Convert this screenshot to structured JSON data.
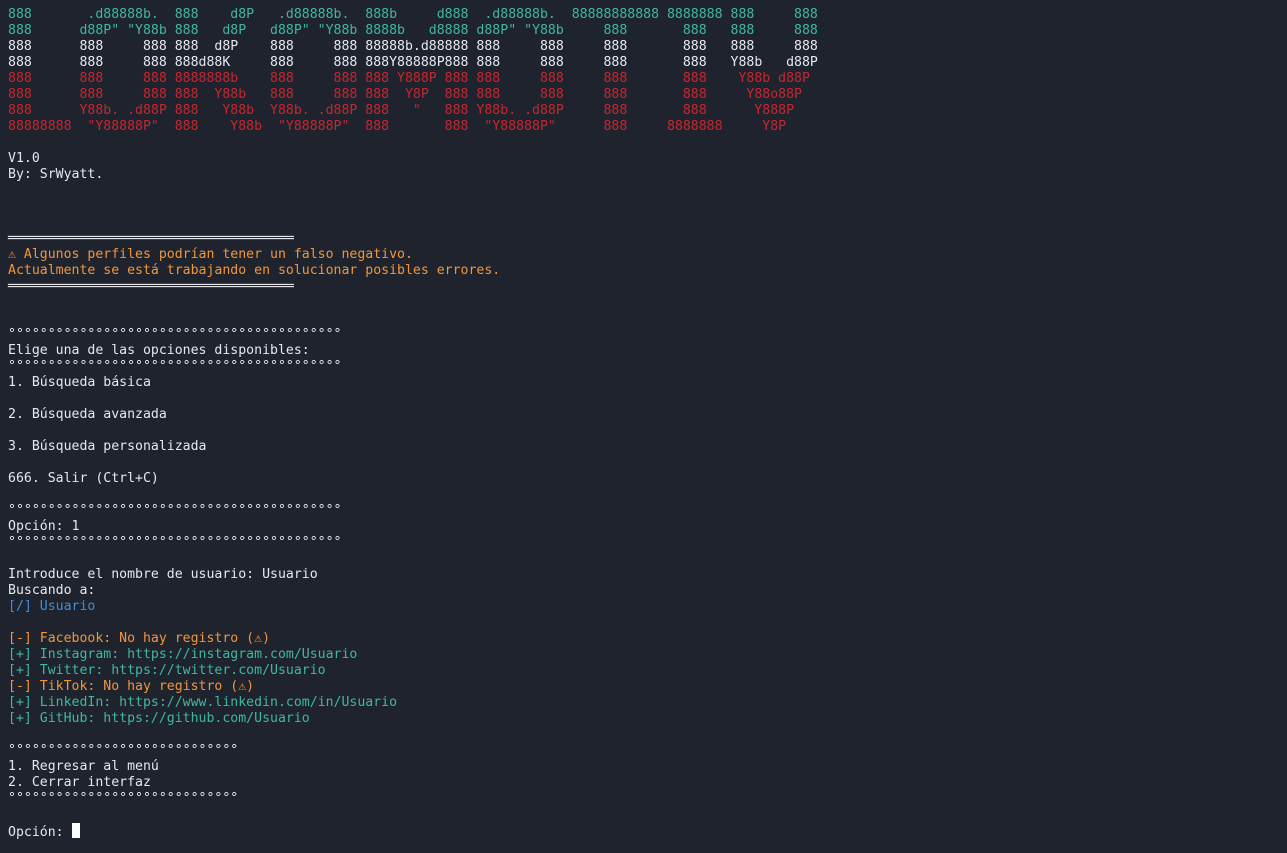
{
  "colors": {
    "background": "#1f232d",
    "default": "#e6e8ec",
    "green": "#3fb8a1",
    "white": "#e6e8ec",
    "red": "#c8262f",
    "orange": "#f0963d",
    "blue": "#3d8ede",
    "teal": "#3fb8a1",
    "cursor": "#ffffff"
  },
  "lines": [
    {
      "color": "green",
      "text": "888       .d88888b.  888    d8P   .d88888b.  888b     d888  .d88888b.  88888888888 8888888 888     888"
    },
    {
      "color": "green",
      "text": "888      d88P\" \"Y88b 888   d8P   d88P\" \"Y88b 8888b   d8888 d88P\" \"Y88b     888       888   888     888"
    },
    {
      "color": "white",
      "text": "888      888     888 888  d8P    888     888 88888b.d88888 888     888     888       888   888     888"
    },
    {
      "color": "white",
      "text": "888      888     888 888d88K     888     888 888Y88888P888 888     888     888       888   Y88b   d88P"
    },
    {
      "color": "red",
      "text": "888      888     888 8888888b    888     888 888 Y888P 888 888     888     888       888    Y88b d88P"
    },
    {
      "color": "red",
      "text": "888      888     888 888  Y88b   888     888 888  Y8P  888 888     888     888       888     Y88o88P"
    },
    {
      "color": "red",
      "text": "888      Y88b. .d88P 888   Y88b  Y88b. .d88P 888   \"   888 Y88b. .d88P     888       888      Y888P"
    },
    {
      "color": "red",
      "text": "88888888  \"Y88888P\"  888    Y88b  \"Y88888P\"  888       888  \"Y88888P\"      888     8888888     Y8P"
    },
    {
      "color": "default",
      "text": ""
    },
    {
      "color": "default",
      "text": "V1.0"
    },
    {
      "color": "default",
      "text": "By: SrWyatt."
    },
    {
      "color": "default",
      "text": ""
    },
    {
      "color": "default",
      "text": ""
    },
    {
      "color": "default",
      "text": ""
    },
    {
      "color": "white",
      "text": "════════════════════════════════════"
    },
    {
      "color": "orange",
      "text": "⚠ Algunos perfiles podrían tener un falso negativo."
    },
    {
      "color": "orange",
      "text": "Actualmente se está trabajando en solucionar posibles errores."
    },
    {
      "color": "white",
      "text": "════════════════════════════════════"
    },
    {
      "color": "default",
      "text": ""
    },
    {
      "color": "default",
      "text": ""
    },
    {
      "color": "default",
      "text": "°°°°°°°°°°°°°°°°°°°°°°°°°°°°°°°°°°°°°°°°°°"
    },
    {
      "color": "default",
      "text": "Elige una de las opciones disponibles:"
    },
    {
      "color": "default",
      "text": "°°°°°°°°°°°°°°°°°°°°°°°°°°°°°°°°°°°°°°°°°°"
    },
    {
      "color": "default",
      "text": "1. Búsqueda básica"
    },
    {
      "color": "default",
      "text": ""
    },
    {
      "color": "default",
      "text": "2. Búsqueda avanzada"
    },
    {
      "color": "default",
      "text": ""
    },
    {
      "color": "default",
      "text": "3. Búsqueda personalizada"
    },
    {
      "color": "default",
      "text": ""
    },
    {
      "color": "default",
      "text": "666. Salir (Ctrl+C)"
    },
    {
      "color": "default",
      "text": ""
    },
    {
      "color": "default",
      "text": "°°°°°°°°°°°°°°°°°°°°°°°°°°°°°°°°°°°°°°°°°°"
    },
    {
      "color": "default",
      "text": "Opción: 1"
    },
    {
      "color": "default",
      "text": "°°°°°°°°°°°°°°°°°°°°°°°°°°°°°°°°°°°°°°°°°°"
    },
    {
      "color": "default",
      "text": ""
    },
    {
      "color": "default",
      "text": "Introduce el nombre de usuario: Usuario"
    },
    {
      "color": "default",
      "text": "Buscando a:"
    },
    {
      "color": "blue",
      "text": "[/] Usuario"
    },
    {
      "color": "default",
      "text": ""
    },
    {
      "color": "orange",
      "text": "[-] Facebook: No hay registro (⚠)"
    },
    {
      "color": "teal",
      "text": "[+] Instagram: https://instagram.com/Usuario"
    },
    {
      "color": "teal",
      "text": "[+] Twitter: https://twitter.com/Usuario"
    },
    {
      "color": "orange",
      "text": "[-] TikTok: No hay registro (⚠)"
    },
    {
      "color": "teal",
      "text": "[+] LinkedIn: https://www.linkedin.com/in/Usuario"
    },
    {
      "color": "teal",
      "text": "[+] GitHub: https://github.com/Usuario"
    },
    {
      "color": "default",
      "text": ""
    },
    {
      "color": "default",
      "text": "°°°°°°°°°°°°°°°°°°°°°°°°°°°°°"
    },
    {
      "color": "default",
      "text": "1. Regresar al menú"
    },
    {
      "color": "default",
      "text": "2. Cerrar interfaz"
    },
    {
      "color": "default",
      "text": "°°°°°°°°°°°°°°°°°°°°°°°°°°°°°"
    },
    {
      "color": "default",
      "text": ""
    }
  ],
  "prompt": {
    "text": "Opción: ",
    "color": "default"
  }
}
